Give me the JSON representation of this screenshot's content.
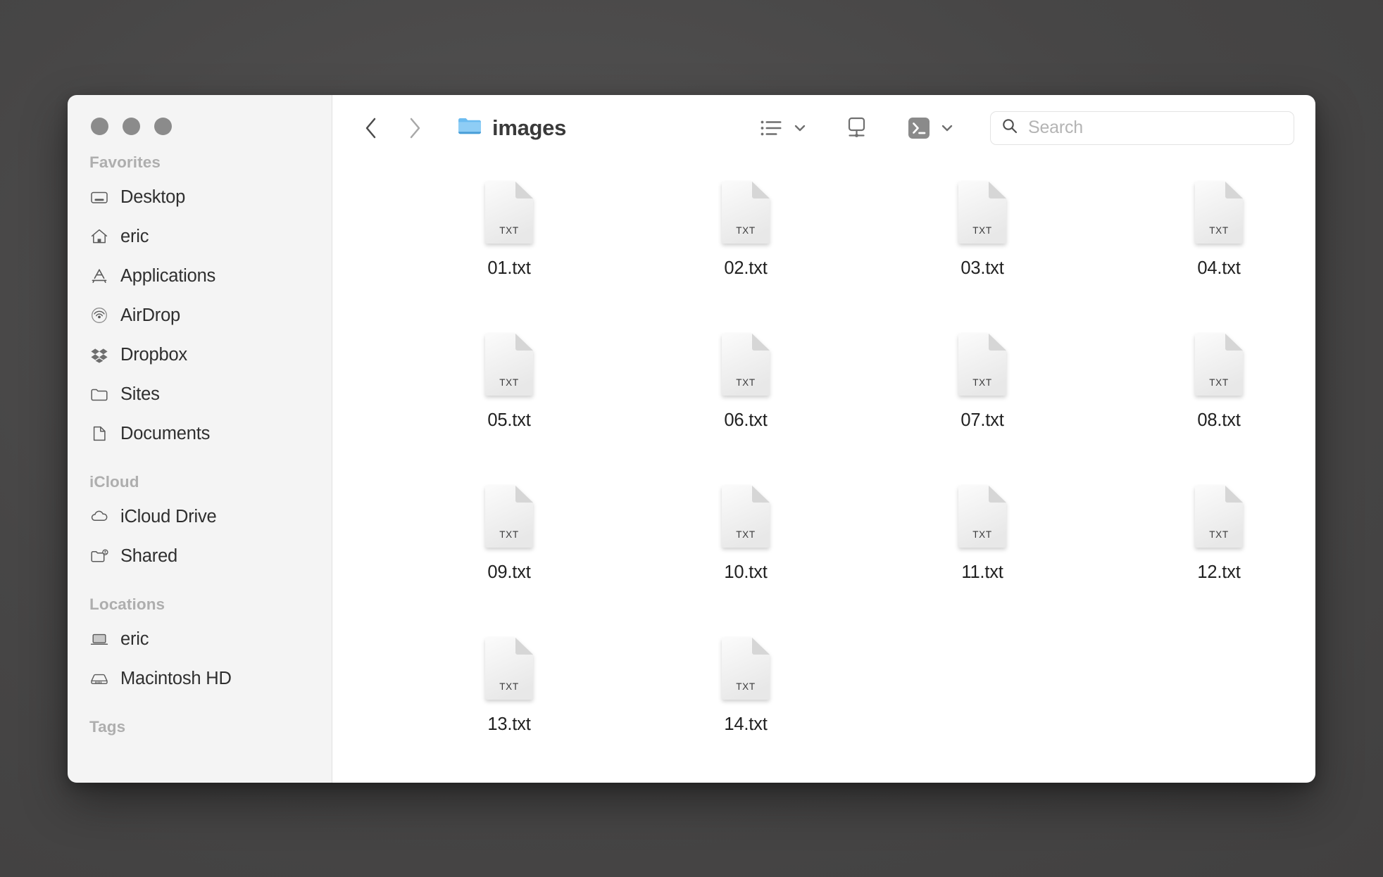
{
  "window": {
    "title": "images",
    "folder_icon": "blue-folder-icon",
    "traffic_lights": [
      {
        "name": "close-button",
        "color": "#8b8b8b"
      },
      {
        "name": "minimize-button",
        "color": "#8b8b8b"
      },
      {
        "name": "maximize-button",
        "color": "#8b8b8b"
      }
    ]
  },
  "toolbar": {
    "back_label": "‹",
    "forward_label": "›",
    "back_icon": "chevron-left-icon",
    "forward_icon": "chevron-right-icon",
    "view_icon": "list-view-icon",
    "view_chevron_icon": "chevron-down-icon",
    "share_icon": "display-screen-icon",
    "terminal_icon": "terminal-icon",
    "terminal_chevron_icon": "chevron-down-icon",
    "terminal_glyph": ">_",
    "terminal_bg": "#8a8a8a"
  },
  "search": {
    "icon": "search-icon",
    "placeholder": "Search",
    "value": ""
  },
  "sidebar": {
    "sections": [
      {
        "header": "Favorites",
        "items": [
          {
            "label": "Desktop",
            "icon": "desktop-icon"
          },
          {
            "label": "eric",
            "icon": "home-icon"
          },
          {
            "label": "Applications",
            "icon": "applications-icon"
          },
          {
            "label": "AirDrop",
            "icon": "airdrop-icon"
          },
          {
            "label": "Dropbox",
            "icon": "dropbox-icon"
          },
          {
            "label": "Sites",
            "icon": "folder-icon"
          },
          {
            "label": "Documents",
            "icon": "document-icon"
          }
        ]
      },
      {
        "header": "iCloud",
        "items": [
          {
            "label": "iCloud Drive",
            "icon": "cloud-icon"
          },
          {
            "label": "Shared",
            "icon": "shared-folder-icon"
          }
        ]
      },
      {
        "header": "Locations",
        "items": [
          {
            "label": "eric",
            "icon": "laptop-icon"
          },
          {
            "label": "Macintosh HD",
            "icon": "hard-drive-icon"
          }
        ]
      },
      {
        "header": "Tags",
        "items": []
      }
    ]
  },
  "files": {
    "type_label": "TXT",
    "items": [
      {
        "name": "01.txt",
        "type": "TXT"
      },
      {
        "name": "02.txt",
        "type": "TXT"
      },
      {
        "name": "03.txt",
        "type": "TXT"
      },
      {
        "name": "04.txt",
        "type": "TXT"
      },
      {
        "name": "05.txt",
        "type": "TXT"
      },
      {
        "name": "06.txt",
        "type": "TXT"
      },
      {
        "name": "07.txt",
        "type": "TXT"
      },
      {
        "name": "08.txt",
        "type": "TXT"
      },
      {
        "name": "09.txt",
        "type": "TXT"
      },
      {
        "name": "10.txt",
        "type": "TXT"
      },
      {
        "name": "11.txt",
        "type": "TXT"
      },
      {
        "name": "12.txt",
        "type": "TXT"
      },
      {
        "name": "13.txt",
        "type": "TXT"
      },
      {
        "name": "14.txt",
        "type": "TXT"
      }
    ]
  },
  "colors": {
    "desktop_bg": "#4b4b4b",
    "sidebar_bg": "#f4f4f4",
    "content_bg": "#ffffff",
    "folder_blue": "#59b0ef",
    "text_primary": "#212121",
    "text_header": "#aeaeae"
  }
}
